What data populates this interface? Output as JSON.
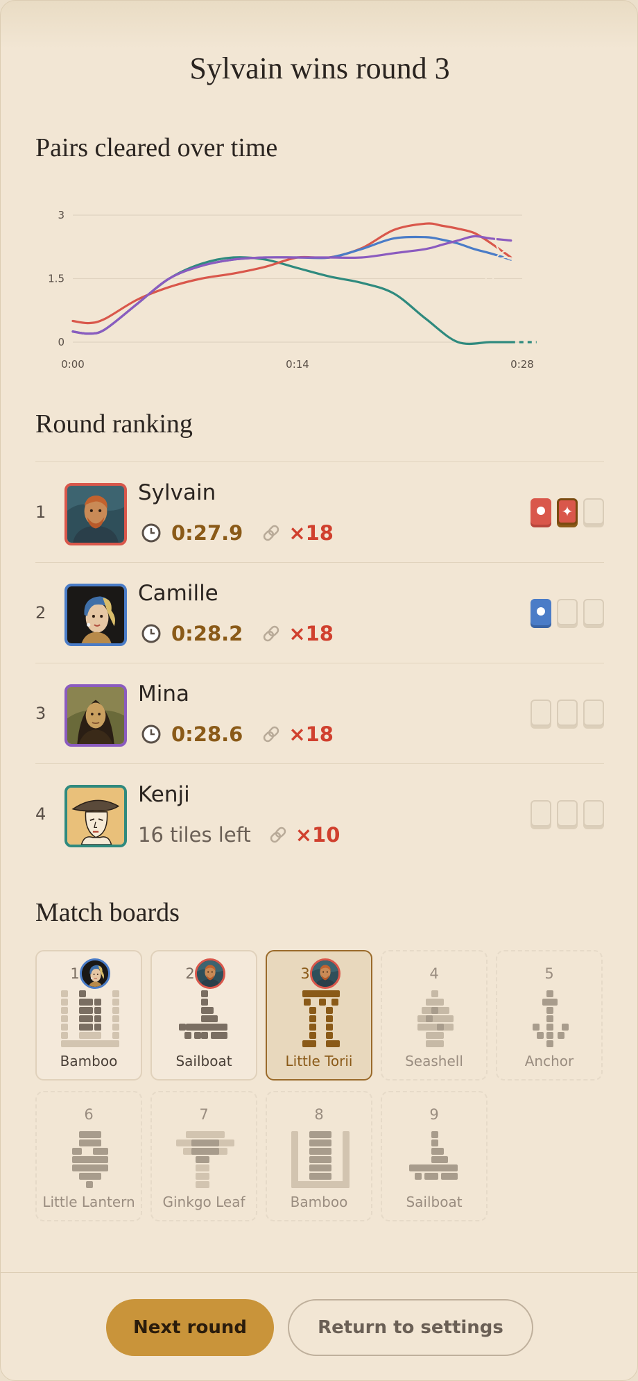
{
  "header": {
    "title": "Sylvain wins round 3"
  },
  "chart_section": {
    "heading": "Pairs cleared over time"
  },
  "chart_data": {
    "type": "line",
    "title": "Pairs cleared over time",
    "xlabel": "",
    "ylabel": "",
    "x_ticks": [
      "0:00",
      "0:14",
      "0:28"
    ],
    "y_ticks": [
      "0",
      "1.5",
      "3"
    ],
    "ylim": [
      0,
      3
    ],
    "xlim": [
      0,
      28
    ],
    "grid": true,
    "series": [
      {
        "player": "Sylvain",
        "color": "#d9574b",
        "x": [
          0,
          1,
          2,
          4,
          6,
          8,
          10,
          12,
          14,
          16,
          18,
          20,
          22,
          23,
          24,
          25,
          26,
          27.3
        ],
        "y": [
          0.5,
          0.45,
          0.55,
          1.0,
          1.3,
          1.5,
          1.62,
          1.78,
          2.0,
          2.0,
          2.22,
          2.65,
          2.8,
          2.75,
          2.68,
          2.58,
          2.35,
          2.0
        ]
      },
      {
        "player": "Camille",
        "color": "#4a7cc7",
        "x": [
          0,
          1,
          2,
          4,
          6,
          8,
          10,
          12,
          14,
          16,
          18,
          20,
          22,
          23,
          24,
          25,
          26,
          27.3
        ],
        "y": [
          0.25,
          0.2,
          0.3,
          0.9,
          1.5,
          1.8,
          1.95,
          2.0,
          2.0,
          2.0,
          2.2,
          2.45,
          2.48,
          2.42,
          2.33,
          2.2,
          2.1,
          1.95
        ]
      },
      {
        "player": "Mina",
        "color": "#8b5bbf",
        "x": [
          0,
          1,
          2,
          4,
          6,
          8,
          10,
          12,
          14,
          16,
          18,
          20,
          22,
          23,
          24,
          25,
          26,
          27.3
        ],
        "y": [
          0.25,
          0.2,
          0.3,
          0.9,
          1.5,
          1.8,
          1.95,
          2.0,
          2.0,
          2.0,
          2.0,
          2.1,
          2.2,
          2.3,
          2.4,
          2.5,
          2.45,
          2.4
        ]
      },
      {
        "player": "Kenji",
        "color": "#2f8a7e",
        "x": [
          0,
          1,
          2,
          4,
          6,
          8,
          10,
          12,
          14,
          16,
          18,
          20,
          22,
          24,
          26,
          27.3
        ],
        "y": [
          0.25,
          0.2,
          0.3,
          0.9,
          1.5,
          1.85,
          2.0,
          1.95,
          1.75,
          1.55,
          1.4,
          1.15,
          0.55,
          0.0,
          0.0,
          0.0
        ],
        "dashed_to": 29.5
      }
    ]
  },
  "ranking": {
    "heading": "Round ranking",
    "rows": [
      {
        "rank": "1",
        "name": "Sylvain",
        "time": "0:27.9",
        "chain": "×18",
        "border": "#d9574b",
        "avatar": "van-gogh-portrait",
        "slots": [
          "red",
          "gold",
          "empty"
        ]
      },
      {
        "rank": "2",
        "name": "Camille",
        "time": "0:28.2",
        "chain": "×18",
        "border": "#4a7cc7",
        "avatar": "girl-with-pearl-earring-portrait",
        "slots": [
          "blue",
          "empty",
          "empty"
        ]
      },
      {
        "rank": "3",
        "name": "Mina",
        "time": "0:28.6",
        "chain": "×18",
        "border": "#8b5bbf",
        "avatar": "mona-lisa-portrait",
        "slots": [
          "empty",
          "empty",
          "empty"
        ]
      },
      {
        "rank": "4",
        "name": "Kenji",
        "tiles_left": "16 tiles left",
        "chain": "×10",
        "border": "#2f8a7e",
        "avatar": "ukiyoe-portrait",
        "slots": [
          "empty",
          "empty",
          "empty"
        ]
      }
    ]
  },
  "boards": {
    "heading": "Match boards",
    "items": [
      {
        "num": "1",
        "name": "Bamboo",
        "state": "played",
        "winner_color": "#4a7cc7"
      },
      {
        "num": "2",
        "name": "Sailboat",
        "state": "played",
        "winner_color": "#d9574b"
      },
      {
        "num": "3",
        "name": "Little Torii",
        "state": "current",
        "winner_color": "#d9574b"
      },
      {
        "num": "4",
        "name": "Seashell",
        "state": "future"
      },
      {
        "num": "5",
        "name": "Anchor",
        "state": "future"
      },
      {
        "num": "6",
        "name": "Little Lantern",
        "state": "future"
      },
      {
        "num": "7",
        "name": "Ginkgo Leaf",
        "state": "future"
      },
      {
        "num": "8",
        "name": "Bamboo",
        "state": "future"
      },
      {
        "num": "9",
        "name": "Sailboat",
        "state": "future"
      }
    ]
  },
  "footer": {
    "next_label": "Next round",
    "settings_label": "Return to settings"
  },
  "colors": {
    "accent": "#c9943a",
    "sylvain": "#d9574b",
    "camille": "#4a7cc7",
    "mina": "#8b5bbf",
    "kenji": "#2f8a7e"
  }
}
